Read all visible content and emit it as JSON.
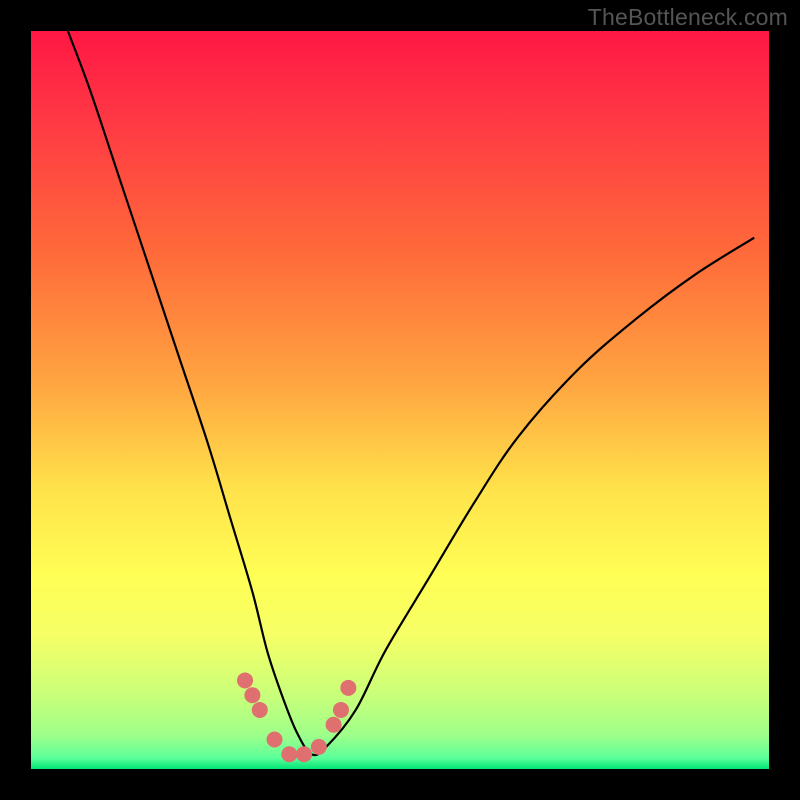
{
  "watermark": "TheBottleneck.com",
  "chart_data": {
    "type": "line",
    "title": "",
    "xlabel": "",
    "ylabel": "",
    "xlim": [
      0,
      100
    ],
    "ylim": [
      0,
      100
    ],
    "gradient_stops": [
      {
        "offset": 0,
        "color": "#ff1744"
      },
      {
        "offset": 0.12,
        "color": "#ff3844"
      },
      {
        "offset": 0.3,
        "color": "#ff6a3a"
      },
      {
        "offset": 0.48,
        "color": "#ffa641"
      },
      {
        "offset": 0.62,
        "color": "#ffe24a"
      },
      {
        "offset": 0.74,
        "color": "#ffff55"
      },
      {
        "offset": 0.82,
        "color": "#f5ff66"
      },
      {
        "offset": 0.9,
        "color": "#c9ff7a"
      },
      {
        "offset": 0.955,
        "color": "#9dff8a"
      },
      {
        "offset": 0.985,
        "color": "#5cff9a"
      },
      {
        "offset": 1.0,
        "color": "#00e676"
      }
    ],
    "series": [
      {
        "name": "bottleneck-curve",
        "x": [
          5,
          8,
          12,
          16,
          20,
          24,
          27,
          30,
          32,
          34,
          36,
          38,
          40,
          44,
          48,
          54,
          60,
          66,
          74,
          82,
          90,
          98
        ],
        "values": [
          100,
          92,
          80,
          68,
          56,
          44,
          34,
          24,
          16,
          10,
          5,
          2,
          3,
          8,
          16,
          26,
          36,
          45,
          54,
          61,
          67,
          72
        ]
      }
    ],
    "markers": {
      "name": "highlighted-points",
      "color": "#e07070",
      "x": [
        29,
        30,
        31,
        33,
        35,
        37,
        39,
        41,
        42,
        43
      ],
      "values": [
        12,
        10,
        8,
        4,
        2,
        2,
        3,
        6,
        8,
        11
      ]
    }
  }
}
